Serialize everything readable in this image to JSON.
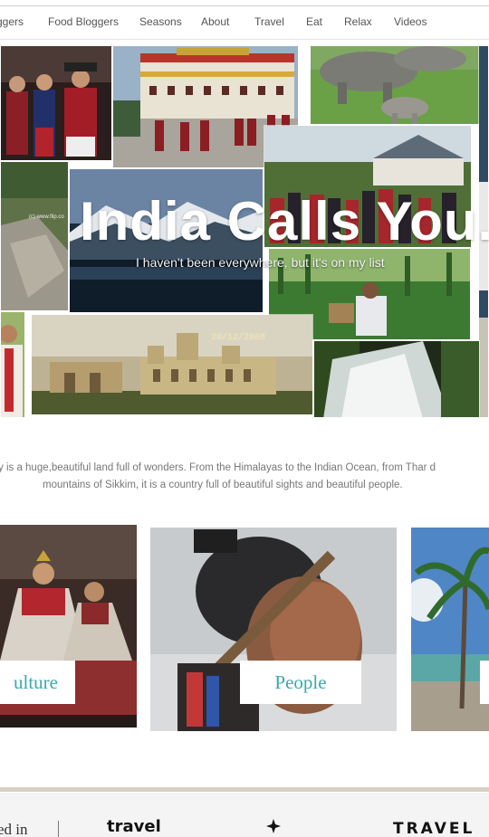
{
  "nav": {
    "items": [
      {
        "label": "ggers"
      },
      {
        "label": "Food Bloggers"
      },
      {
        "label": "Seasons"
      },
      {
        "label": "About"
      },
      {
        "label": "Travel"
      },
      {
        "label": "Eat"
      },
      {
        "label": "Relax"
      },
      {
        "label": "Videos"
      }
    ]
  },
  "hero": {
    "title": "India Calls You.",
    "subtitle": "I haven't been everywhere, but it's on my list",
    "watermark": "(c) www.flip.co",
    "date_stamp": "20/12/2008"
  },
  "intro": {
    "line1": "y is a huge,beautiful land full of wonders. From the Himalayas to the Indian Ocean, from Thar d",
    "line2": "mountains of Sikkim, it is a country full of beautiful sights and beautiful people."
  },
  "cards": [
    {
      "label": "ulture"
    },
    {
      "label": "People"
    },
    {
      "label": ""
    }
  ],
  "press": {
    "featured_text": "ed in",
    "logo1": "travel",
    "logo2": "TRAVEL"
  },
  "colors": {
    "accent_teal": "#3aa8ae",
    "nav_text": "#555555",
    "body_text": "#777777"
  }
}
